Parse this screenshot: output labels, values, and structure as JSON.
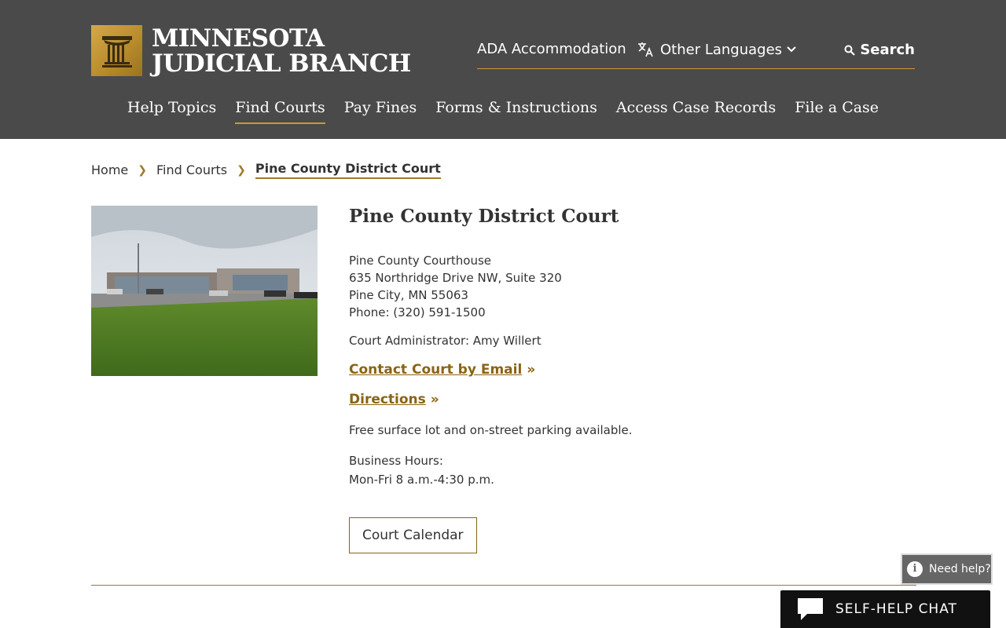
{
  "brand": {
    "line1": "MINNESOTA",
    "line2": "JUDICIAL BRANCH"
  },
  "utility": {
    "ada": "ADA Accommodation",
    "languages": "Other Languages",
    "search": "Search"
  },
  "nav": {
    "items": [
      {
        "label": "Help Topics",
        "active": false
      },
      {
        "label": "Find Courts",
        "active": true
      },
      {
        "label": "Pay Fines",
        "active": false
      },
      {
        "label": "Forms & Instructions",
        "active": false
      },
      {
        "label": "Access Case Records",
        "active": false
      },
      {
        "label": "File a Case",
        "active": false
      }
    ]
  },
  "breadcrumb": {
    "home": "Home",
    "parent": "Find Courts",
    "current": "Pine County District Court"
  },
  "court": {
    "title": "Pine County District Court",
    "building": "Pine County Courthouse",
    "street": "635 Northridge Drive NW, Suite 320",
    "city": "Pine City, MN 55063",
    "phone": "Phone: (320) 591-1500",
    "admin": "Court Administrator: Amy Willert",
    "email_link": "Contact Court by Email",
    "directions_link": "Directions",
    "link_suffix": "»",
    "parking": "Free surface lot and on-street parking available.",
    "hours_label": "Business Hours:",
    "hours": "Mon-Fri 8 a.m.-4:30 p.m.",
    "calendar_button": "Court Calendar"
  },
  "widgets": {
    "need_help": "Need help?",
    "chat": "SELF-HELP CHAT"
  },
  "colors": {
    "header_bg": "#4a4a4a",
    "accent_gold": "#c99a3a",
    "link_gold": "#8a6414"
  }
}
